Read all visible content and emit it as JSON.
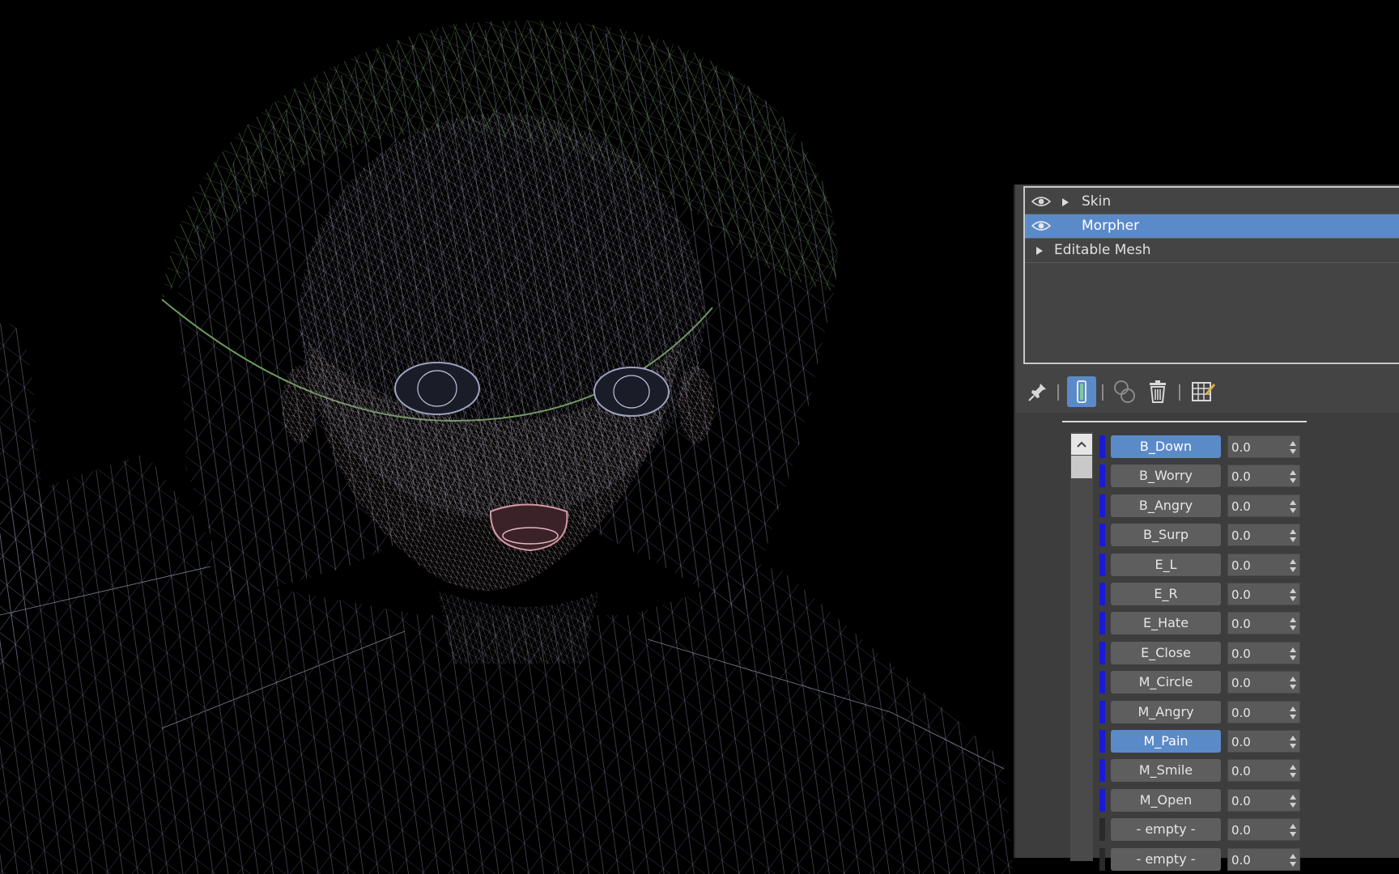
{
  "viewport": {
    "description_icon": "wireframe-character-head"
  },
  "modifier_stack": {
    "items": [
      {
        "label": "Skin",
        "visible_toggle": true,
        "expandable": true,
        "selected": false
      },
      {
        "label": "Morpher",
        "visible_toggle": true,
        "expandable": false,
        "selected": true
      },
      {
        "label": "Editable Mesh",
        "visible_toggle": false,
        "expandable": true,
        "selected": false
      }
    ]
  },
  "toolbar": {
    "icons": [
      "pin-stack-icon",
      "show-end-result-icon",
      "make-unique-icon",
      "remove-modifier-icon",
      "configure-modifier-sets-icon"
    ]
  },
  "channels": [
    {
      "name": "B_Down",
      "value": "0.0",
      "active": true,
      "empty": false
    },
    {
      "name": "B_Worry",
      "value": "0.0",
      "active": false,
      "empty": false
    },
    {
      "name": "B_Angry",
      "value": "0.0",
      "active": false,
      "empty": false
    },
    {
      "name": "B_Surp",
      "value": "0.0",
      "active": false,
      "empty": false
    },
    {
      "name": "E_L",
      "value": "0.0",
      "active": false,
      "empty": false
    },
    {
      "name": "E_R",
      "value": "0.0",
      "active": false,
      "empty": false
    },
    {
      "name": "E_Hate",
      "value": "0.0",
      "active": false,
      "empty": false
    },
    {
      "name": "E_Close",
      "value": "0.0",
      "active": false,
      "empty": false
    },
    {
      "name": "M_Circle",
      "value": "0.0",
      "active": false,
      "empty": false
    },
    {
      "name": "M_Angry",
      "value": "0.0",
      "active": false,
      "empty": false
    },
    {
      "name": "M_Pain",
      "value": "0.0",
      "active": true,
      "empty": false
    },
    {
      "name": "M_Smile",
      "value": "0.0",
      "active": false,
      "empty": false
    },
    {
      "name": "M_Open",
      "value": "0.0",
      "active": false,
      "empty": false
    },
    {
      "name": "- empty -",
      "value": "0.0",
      "active": false,
      "empty": true
    },
    {
      "name": "- empty -",
      "value": "0.0",
      "active": false,
      "empty": true
    }
  ],
  "colors": {
    "accent": "#5b8ac9",
    "panel": "#444444",
    "channel_swatch": "#1a1ad6"
  }
}
